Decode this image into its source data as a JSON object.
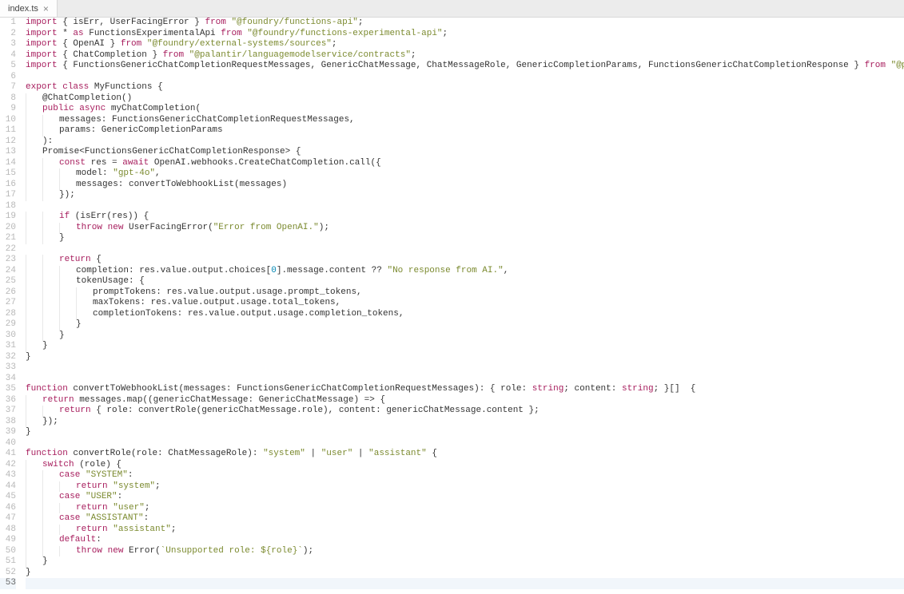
{
  "tab": {
    "filename": "index.ts",
    "close_glyph": "×"
  },
  "current_line": 53,
  "lines": [
    {
      "n": 1,
      "tokens": [
        [
          "kw",
          "import"
        ],
        [
          "punc",
          " { "
        ],
        [
          "ident",
          "isErr, UserFacingError"
        ],
        [
          "punc",
          " } "
        ],
        [
          "kw",
          "from"
        ],
        [
          "punc",
          " "
        ],
        [
          "str",
          "\"@foundry/functions-api\""
        ],
        [
          "punc",
          ";"
        ]
      ]
    },
    {
      "n": 2,
      "tokens": [
        [
          "kw",
          "import"
        ],
        [
          "punc",
          " * "
        ],
        [
          "kw",
          "as"
        ],
        [
          "punc",
          " "
        ],
        [
          "ident",
          "FunctionsExperimentalApi "
        ],
        [
          "kw",
          "from"
        ],
        [
          "punc",
          " "
        ],
        [
          "str",
          "\"@foundry/functions-experimental-api\""
        ],
        [
          "punc",
          ";"
        ]
      ]
    },
    {
      "n": 3,
      "tokens": [
        [
          "kw",
          "import"
        ],
        [
          "punc",
          " { "
        ],
        [
          "ident",
          "OpenAI"
        ],
        [
          "punc",
          " } "
        ],
        [
          "kw",
          "from"
        ],
        [
          "punc",
          " "
        ],
        [
          "str",
          "\"@foundry/external-systems/sources\""
        ],
        [
          "punc",
          ";"
        ]
      ]
    },
    {
      "n": 4,
      "tokens": [
        [
          "kw",
          "import"
        ],
        [
          "punc",
          " { "
        ],
        [
          "ident",
          "ChatCompletion"
        ],
        [
          "punc",
          " } "
        ],
        [
          "kw",
          "from"
        ],
        [
          "punc",
          " "
        ],
        [
          "str",
          "\"@palantir/languagemodelservice/contracts\""
        ],
        [
          "punc",
          ";"
        ]
      ]
    },
    {
      "n": 5,
      "tokens": [
        [
          "kw",
          "import"
        ],
        [
          "punc",
          " { "
        ],
        [
          "ident",
          "FunctionsGenericChatCompletionRequestMessages, GenericChatMessage, ChatMessageRole, GenericCompletionParams, FunctionsGenericChatCompletionResponse"
        ],
        [
          "punc",
          " } "
        ],
        [
          "kw",
          "from"
        ],
        [
          "punc",
          " "
        ],
        [
          "str",
          "\"@palantir/languagemodelservice/api\""
        ],
        [
          "punc",
          ";"
        ]
      ]
    },
    {
      "n": 6,
      "tokens": []
    },
    {
      "n": 7,
      "tokens": [
        [
          "kw",
          "export"
        ],
        [
          "punc",
          " "
        ],
        [
          "kw",
          "class"
        ],
        [
          "punc",
          " "
        ],
        [
          "ident",
          "MyFunctions"
        ],
        [
          "punc",
          " {"
        ]
      ]
    },
    {
      "n": 8,
      "indent": 1,
      "tokens": [
        [
          "ident",
          "@ChatCompletion"
        ],
        [
          "punc",
          "()"
        ]
      ]
    },
    {
      "n": 9,
      "indent": 1,
      "tokens": [
        [
          "kw",
          "public"
        ],
        [
          "punc",
          " "
        ],
        [
          "kw",
          "async"
        ],
        [
          "punc",
          " "
        ],
        [
          "ident",
          "myChatCompletion"
        ],
        [
          "punc",
          "("
        ]
      ]
    },
    {
      "n": 10,
      "indent": 2,
      "tokens": [
        [
          "ident",
          "messages: FunctionsGenericChatCompletionRequestMessages,"
        ]
      ]
    },
    {
      "n": 11,
      "indent": 2,
      "tokens": [
        [
          "ident",
          "params: GenericCompletionParams"
        ]
      ]
    },
    {
      "n": 12,
      "indent": 1,
      "tokens": [
        [
          "punc",
          "):"
        ]
      ]
    },
    {
      "n": 13,
      "indent": 1,
      "tokens": [
        [
          "ident",
          "Promise<FunctionsGenericChatCompletionResponse> {"
        ]
      ]
    },
    {
      "n": 14,
      "indent": 2,
      "tokens": [
        [
          "kw",
          "const"
        ],
        [
          "punc",
          " "
        ],
        [
          "ident",
          "res = "
        ],
        [
          "kw",
          "await"
        ],
        [
          "punc",
          " "
        ],
        [
          "ident",
          "OpenAI.webhooks.CreateChatCompletion.call"
        ],
        [
          "punc",
          "({"
        ]
      ]
    },
    {
      "n": 15,
      "indent": 3,
      "tokens": [
        [
          "ident",
          "model: "
        ],
        [
          "str",
          "\"gpt-4o\""
        ],
        [
          "punc",
          ","
        ]
      ]
    },
    {
      "n": 16,
      "indent": 3,
      "tokens": [
        [
          "ident",
          "messages: convertToWebhookList(messages)"
        ]
      ]
    },
    {
      "n": 17,
      "indent": 2,
      "tokens": [
        [
          "punc",
          "});"
        ]
      ]
    },
    {
      "n": 18,
      "indent": 0,
      "tokens": []
    },
    {
      "n": 19,
      "indent": 2,
      "tokens": [
        [
          "kw",
          "if"
        ],
        [
          "punc",
          " (isErr(res)) {"
        ]
      ]
    },
    {
      "n": 20,
      "indent": 3,
      "tokens": [
        [
          "kw",
          "throw"
        ],
        [
          "punc",
          " "
        ],
        [
          "kw",
          "new"
        ],
        [
          "punc",
          " "
        ],
        [
          "ident",
          "UserFacingError"
        ],
        [
          "punc",
          "("
        ],
        [
          "str",
          "\"Error from OpenAI.\""
        ],
        [
          "punc",
          ");"
        ]
      ]
    },
    {
      "n": 21,
      "indent": 2,
      "tokens": [
        [
          "punc",
          "}"
        ]
      ]
    },
    {
      "n": 22,
      "indent": 0,
      "tokens": []
    },
    {
      "n": 23,
      "indent": 2,
      "tokens": [
        [
          "kw",
          "return"
        ],
        [
          "punc",
          " {"
        ]
      ]
    },
    {
      "n": 24,
      "indent": 3,
      "tokens": [
        [
          "ident",
          "completion: res.value.output.choices["
        ],
        [
          "num",
          "0"
        ],
        [
          "ident",
          "].message.content ?? "
        ],
        [
          "str",
          "\"No response from AI.\""
        ],
        [
          "punc",
          ","
        ]
      ]
    },
    {
      "n": 25,
      "indent": 3,
      "tokens": [
        [
          "ident",
          "tokenUsage: {"
        ]
      ]
    },
    {
      "n": 26,
      "indent": 4,
      "tokens": [
        [
          "ident",
          "promptTokens: res.value.output.usage.prompt_tokens,"
        ]
      ]
    },
    {
      "n": 27,
      "indent": 4,
      "tokens": [
        [
          "ident",
          "maxTokens: res.value.output.usage.total_tokens,"
        ]
      ]
    },
    {
      "n": 28,
      "indent": 4,
      "tokens": [
        [
          "ident",
          "completionTokens: res.value.output.usage.completion_tokens,"
        ]
      ]
    },
    {
      "n": 29,
      "indent": 3,
      "tokens": [
        [
          "punc",
          "}"
        ]
      ]
    },
    {
      "n": 30,
      "indent": 2,
      "tokens": [
        [
          "punc",
          "}"
        ]
      ]
    },
    {
      "n": 31,
      "indent": 1,
      "tokens": [
        [
          "punc",
          "}"
        ]
      ]
    },
    {
      "n": 32,
      "indent": 0,
      "tokens": [
        [
          "punc",
          "}"
        ]
      ]
    },
    {
      "n": 33,
      "tokens": []
    },
    {
      "n": 34,
      "tokens": []
    },
    {
      "n": 35,
      "tokens": [
        [
          "kw",
          "function"
        ],
        [
          "punc",
          " "
        ],
        [
          "ident",
          "convertToWebhookList"
        ],
        [
          "punc",
          "(messages: FunctionsGenericChatCompletionRequestMessages): { role: "
        ],
        [
          "type",
          "string"
        ],
        [
          "punc",
          "; content: "
        ],
        [
          "type",
          "string"
        ],
        [
          "punc",
          "; }[]  {"
        ]
      ]
    },
    {
      "n": 36,
      "indent": 1,
      "tokens": [
        [
          "kw",
          "return"
        ],
        [
          "punc",
          " messages.map((genericChatMessage: GenericChatMessage) => {"
        ]
      ]
    },
    {
      "n": 37,
      "indent": 2,
      "tokens": [
        [
          "kw",
          "return"
        ],
        [
          "punc",
          " { role: convertRole(genericChatMessage.role), content: genericChatMessage.content };"
        ]
      ]
    },
    {
      "n": 38,
      "indent": 1,
      "tokens": [
        [
          "punc",
          "});"
        ]
      ]
    },
    {
      "n": 39,
      "tokens": [
        [
          "punc",
          "}"
        ]
      ]
    },
    {
      "n": 40,
      "tokens": []
    },
    {
      "n": 41,
      "tokens": [
        [
          "kw",
          "function"
        ],
        [
          "punc",
          " "
        ],
        [
          "ident",
          "convertRole"
        ],
        [
          "punc",
          "(role: ChatMessageRole): "
        ],
        [
          "str",
          "\"system\""
        ],
        [
          "punc",
          " | "
        ],
        [
          "str",
          "\"user\""
        ],
        [
          "punc",
          " | "
        ],
        [
          "str",
          "\"assistant\""
        ],
        [
          "punc",
          " {"
        ]
      ]
    },
    {
      "n": 42,
      "indent": 1,
      "tokens": [
        [
          "kw",
          "switch"
        ],
        [
          "punc",
          " (role) {"
        ]
      ]
    },
    {
      "n": 43,
      "indent": 2,
      "tokens": [
        [
          "kw",
          "case"
        ],
        [
          "punc",
          " "
        ],
        [
          "str",
          "\"SYSTEM\""
        ],
        [
          "punc",
          ":"
        ]
      ]
    },
    {
      "n": 44,
      "indent": 3,
      "tokens": [
        [
          "kw",
          "return"
        ],
        [
          "punc",
          " "
        ],
        [
          "str",
          "\"system\""
        ],
        [
          "punc",
          ";"
        ]
      ]
    },
    {
      "n": 45,
      "indent": 2,
      "tokens": [
        [
          "kw",
          "case"
        ],
        [
          "punc",
          " "
        ],
        [
          "str",
          "\"USER\""
        ],
        [
          "punc",
          ":"
        ]
      ]
    },
    {
      "n": 46,
      "indent": 3,
      "tokens": [
        [
          "kw",
          "return"
        ],
        [
          "punc",
          " "
        ],
        [
          "str",
          "\"user\""
        ],
        [
          "punc",
          ";"
        ]
      ]
    },
    {
      "n": 47,
      "indent": 2,
      "tokens": [
        [
          "kw",
          "case"
        ],
        [
          "punc",
          " "
        ],
        [
          "str",
          "\"ASSISTANT\""
        ],
        [
          "punc",
          ":"
        ]
      ]
    },
    {
      "n": 48,
      "indent": 3,
      "tokens": [
        [
          "kw",
          "return"
        ],
        [
          "punc",
          " "
        ],
        [
          "str",
          "\"assistant\""
        ],
        [
          "punc",
          ";"
        ]
      ]
    },
    {
      "n": 49,
      "indent": 2,
      "tokens": [
        [
          "kw",
          "default"
        ],
        [
          "punc",
          ":"
        ]
      ]
    },
    {
      "n": 50,
      "indent": 3,
      "tokens": [
        [
          "kw",
          "throw"
        ],
        [
          "punc",
          " "
        ],
        [
          "kw",
          "new"
        ],
        [
          "punc",
          " "
        ],
        [
          "ident",
          "Error"
        ],
        [
          "punc",
          "("
        ],
        [
          "str",
          "`Unsupported role: ${role}`"
        ],
        [
          "punc",
          ");"
        ]
      ]
    },
    {
      "n": 51,
      "indent": 1,
      "tokens": [
        [
          "punc",
          "}"
        ]
      ]
    },
    {
      "n": 52,
      "tokens": [
        [
          "punc",
          "}"
        ]
      ]
    },
    {
      "n": 53,
      "tokens": []
    }
  ]
}
